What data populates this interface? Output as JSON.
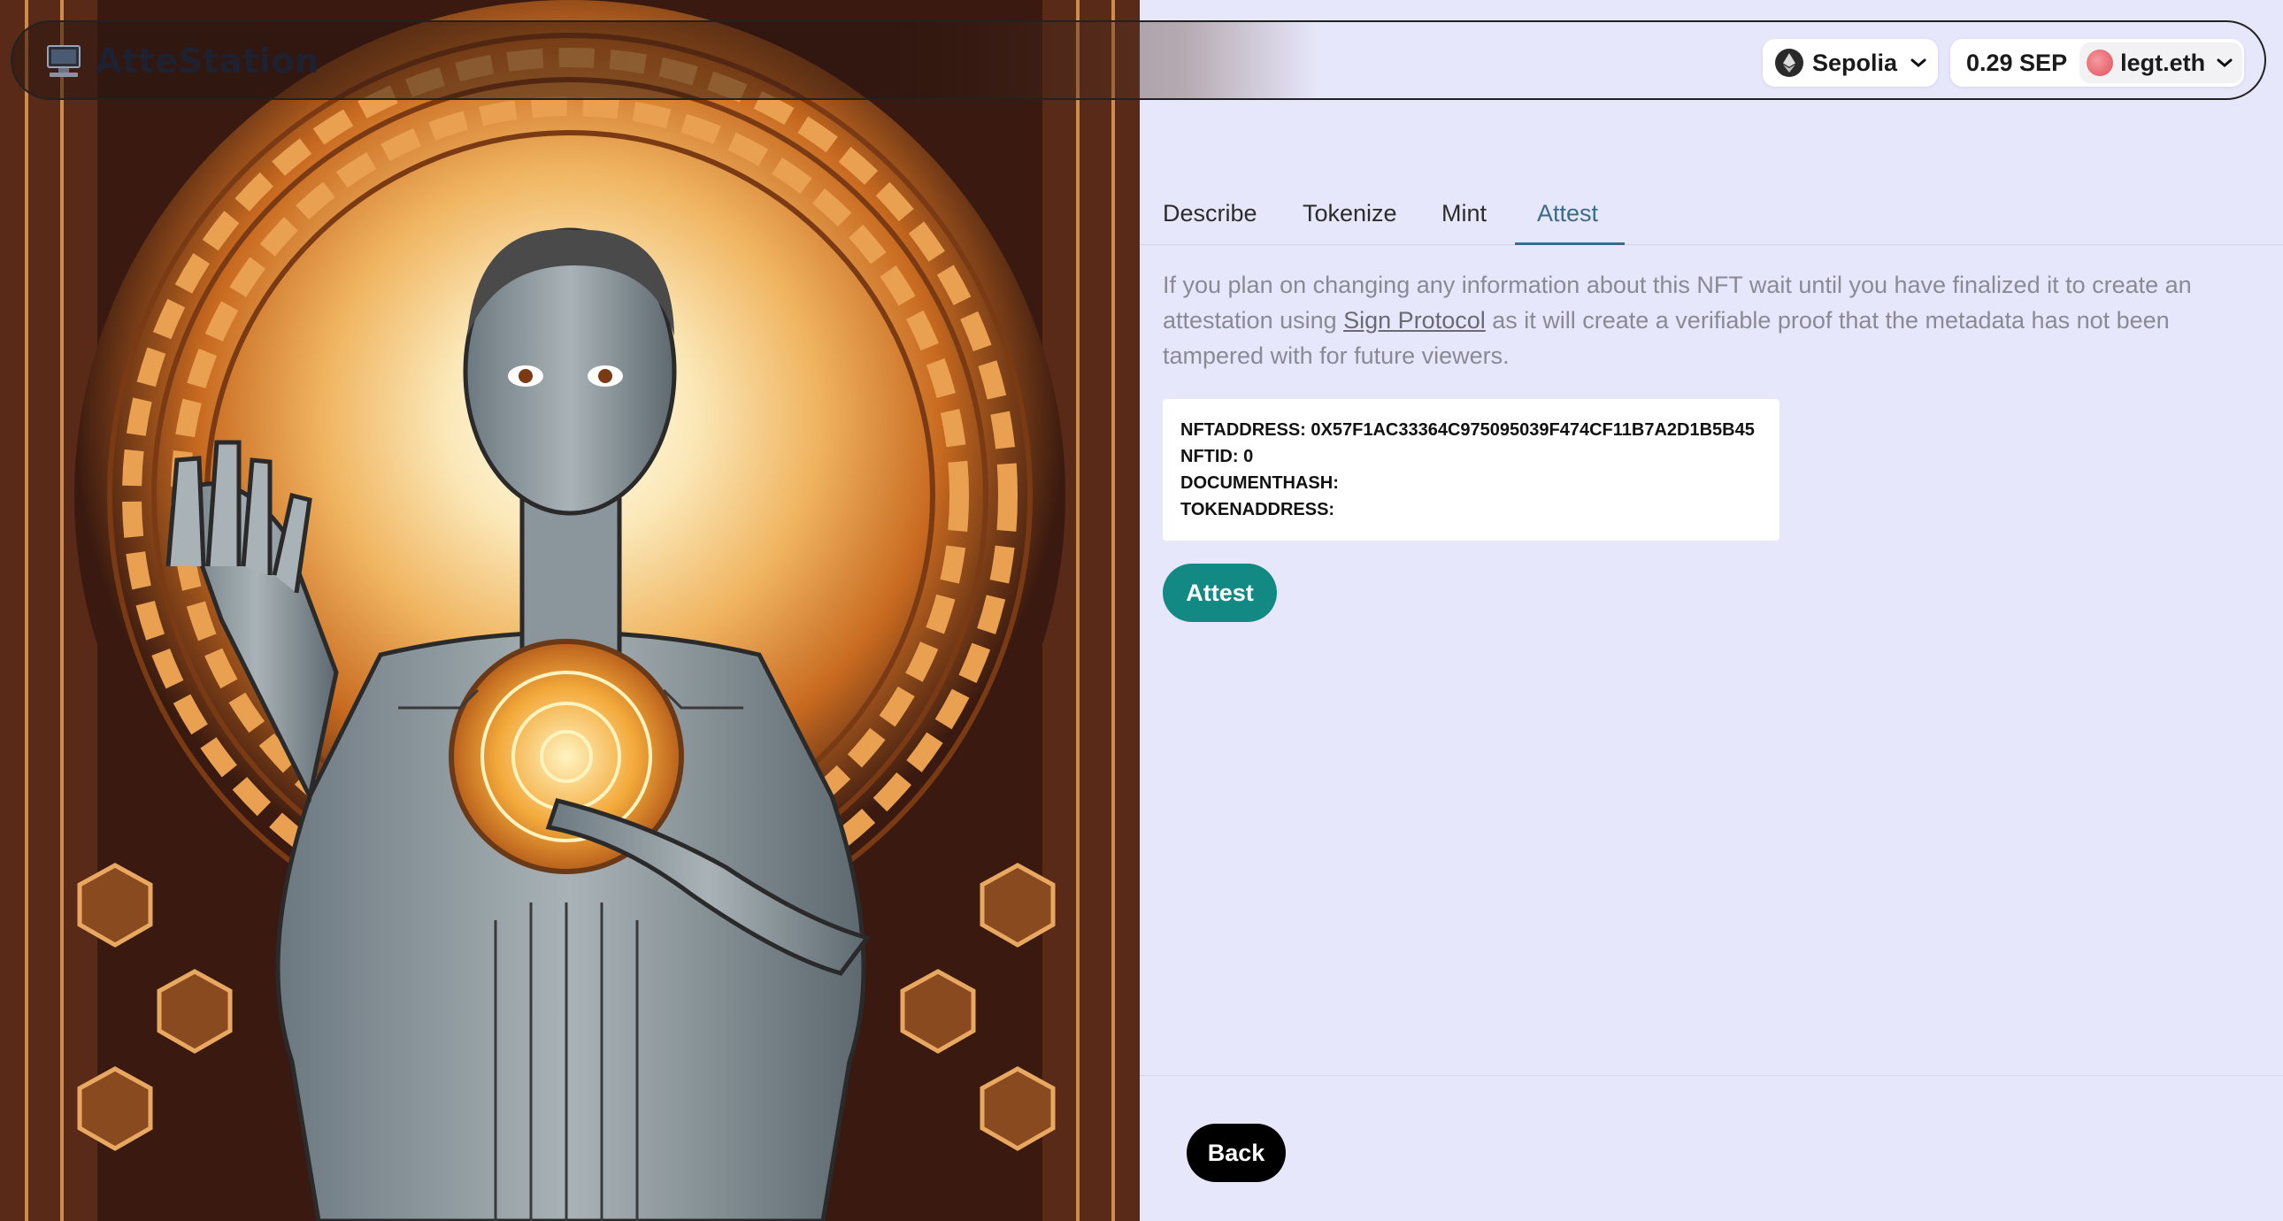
{
  "header": {
    "app_title": "AtteStation",
    "logo_icon": "computer-icon",
    "network": {
      "label": "Sepolia",
      "icon": "ethereum-icon"
    },
    "account": {
      "balance": "0.29 SEP",
      "name": "legt.eth",
      "avatar_color": "#e8626a"
    }
  },
  "artwork": {
    "description_icon": "nft-artwork-image",
    "palette": {
      "dark": "#3a1a10",
      "orange": "#e8922e",
      "light": "#fdf3d8",
      "steel": "#8a959c"
    }
  },
  "tabs": [
    {
      "label": "Describe",
      "active": false
    },
    {
      "label": "Tokenize",
      "active": false
    },
    {
      "label": "Mint",
      "active": false
    },
    {
      "label": "Attest",
      "active": true
    }
  ],
  "attest": {
    "description_before": "If you plan on changing any information about this NFT wait until you have finalized it to create an attestation using ",
    "link_text": "Sign Protocol",
    "description_after": " as it will create a verifiable proof that the metadata has not been tampered with for future viewers.",
    "fields": [
      "NFTADDRESS: 0X57F1AC33364C975095039F474CF11B7A2D1B5B45",
      "NFTID: 0",
      "DOCUMENTHASH:",
      "TOKENADDRESS:"
    ],
    "button_label": "Attest"
  },
  "footer": {
    "back_label": "Back"
  },
  "colors": {
    "accent": "#128a83",
    "tab_active": "#3a6b8a",
    "background": "#e7e7fb"
  }
}
